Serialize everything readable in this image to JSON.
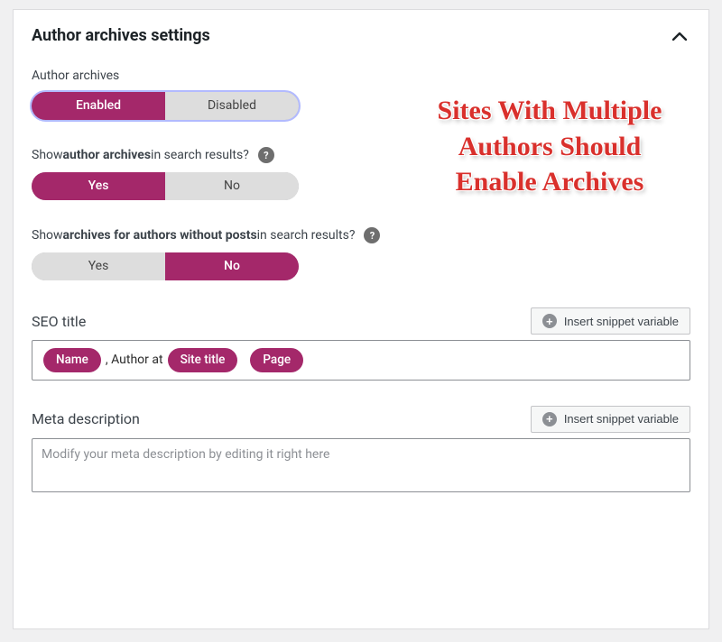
{
  "panel": {
    "title": "Author archives settings"
  },
  "settings": {
    "author_archives": {
      "label": "Author archives",
      "opt_on": "Enabled",
      "opt_off": "Disabled",
      "value": "Enabled"
    },
    "show_in_search": {
      "label_pre": "Show ",
      "label_bold": "author archives",
      "label_post": " in search results?",
      "opt_on": "Yes",
      "opt_off": "No",
      "value": "Yes"
    },
    "show_empty_authors": {
      "label_pre": "Show ",
      "label_bold": "archives for authors without posts",
      "label_post": " in search results?",
      "opt_on": "Yes",
      "opt_off": "No",
      "value": "No"
    }
  },
  "seo_title": {
    "title": "SEO title",
    "insert_label": "Insert snippet variable",
    "chips": {
      "name": "Name",
      "between": " , Author at ",
      "site": "Site title",
      "page": "Page"
    }
  },
  "meta_desc": {
    "title": "Meta description",
    "insert_label": "Insert snippet variable",
    "placeholder": "Modify your meta description by editing it right here"
  },
  "overlay": {
    "text": "Sites With Multiple Authors Should Enable Archives"
  }
}
